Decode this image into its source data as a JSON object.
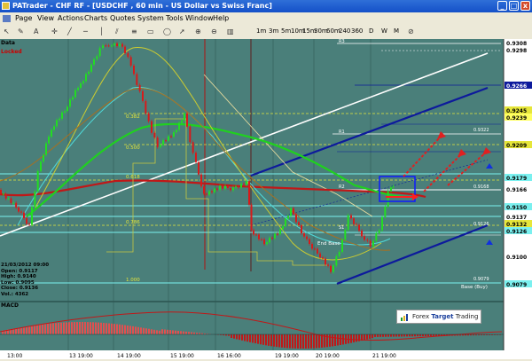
{
  "window": {
    "title": "PATrader - CHF RF - [USDCHF , 60 min - US Dollar vs Swiss Franc]"
  },
  "menu": [
    "Page",
    "View",
    "Actions",
    "Charts",
    "Quotes",
    "System",
    "Tools",
    "Window",
    "Help"
  ],
  "toolbar": {
    "timeframes": [
      "1m",
      "3m",
      "5m",
      "10m",
      "15m",
      "30m",
      "60m",
      "240",
      "360",
      "D",
      "W",
      "M"
    ]
  },
  "panes": {
    "data_label": "Data",
    "locked_label": "Locked",
    "macd_label": "MACD"
  },
  "ohlc": {
    "date": "21/03/2012 09:00",
    "open": "Open: 0.9117",
    "high": "High: 0.9140",
    "low": "Low: 0.9095",
    "close": "Close: 0.9136",
    "vol": "Vol.: 4362"
  },
  "price_axis": {
    "labels": [
      "0.9308",
      "0.9298",
      "0.9266",
      "0.9245",
      "0.9239",
      "0.9209",
      "0.9179",
      "0.9166",
      "0.9150",
      "0.9137",
      "0.9132",
      "0.9126",
      "0.9100",
      "0.9079"
    ],
    "current_price": "0.9166"
  },
  "time_axis": [
    "13:00",
    "13 19:00",
    "14 19:00",
    "15 19:00",
    "16 16:00",
    "19 19:00",
    "20 19:00",
    "21 19:00"
  ],
  "fib_levels": [
    {
      "label": "0.382"
    },
    {
      "label": "0.500"
    },
    {
      "label": "0.618"
    },
    {
      "label": "0.786"
    },
    {
      "label": "1.000"
    }
  ],
  "level_tags": {
    "r1": "R1",
    "r2": "R2",
    "r3": "R3",
    "s1": "S1",
    "r1_value": "0.9322",
    "r2_value": "0.9168",
    "s1_value": "0.9126",
    "base_value": "0.9079"
  },
  "annotations": {
    "base_label": "Base (Buy)",
    "end_base_label": "End Base"
  },
  "brand": {
    "name_prefix": "Forex ",
    "name_bold": "Target",
    "name_suffix": " Trading"
  },
  "colors": {
    "background": "#4a7f7a",
    "bull": "#22dd22",
    "bear": "#d81a1a",
    "channel": "#0d1a9c",
    "fib": "#e6e63a"
  }
}
